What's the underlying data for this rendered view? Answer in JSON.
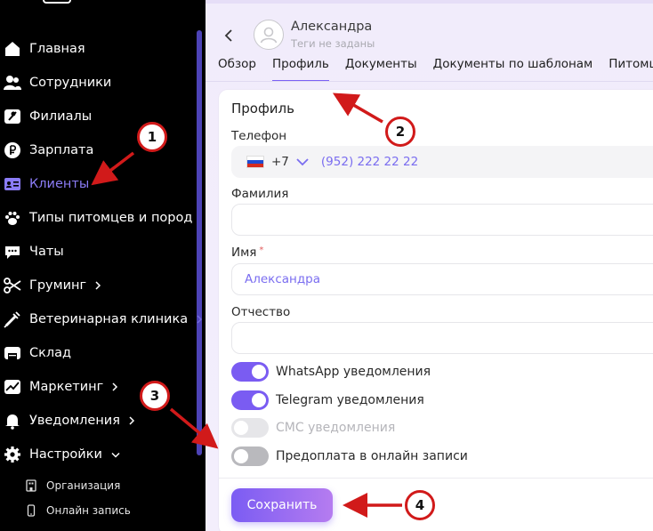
{
  "sidebar": {
    "items": [
      {
        "label": "Главная",
        "icon": "home-icon"
      },
      {
        "label": "Сотрудники",
        "icon": "people-icon"
      },
      {
        "label": "Филиалы",
        "icon": "map-pin-icon"
      },
      {
        "label": "Зарплата",
        "icon": "ruble-icon"
      },
      {
        "label": "Клиенты",
        "icon": "contact-card-icon",
        "active": true
      },
      {
        "label": "Типы питомцев и пород",
        "icon": "paw-icon"
      },
      {
        "label": "Чаты",
        "icon": "chat-icon"
      },
      {
        "label": "Груминг",
        "icon": "scissors-icon",
        "expandable": true
      },
      {
        "label": "Ветеринарная клиника",
        "icon": "syringe-icon",
        "expandable": true
      },
      {
        "label": "Склад",
        "icon": "warehouse-icon"
      },
      {
        "label": "Маркетинг",
        "icon": "chart-icon",
        "expandable": true
      },
      {
        "label": "Уведомления",
        "icon": "bell-icon",
        "expandable": true
      },
      {
        "label": "Настройки",
        "icon": "gear-icon",
        "expanded": true
      }
    ],
    "subitems": [
      {
        "label": "Организация",
        "icon": "building-icon"
      },
      {
        "label": "Онлайн запись",
        "icon": "phone-icon"
      }
    ],
    "active_color": "#8b7cf6"
  },
  "header": {
    "client_name": "Александра",
    "tags_placeholder": "Теги не заданы"
  },
  "tabs": [
    {
      "label": "Обзор"
    },
    {
      "label": "Профиль",
      "active": true
    },
    {
      "label": "Документы"
    },
    {
      "label": "Документы по шаблонам"
    },
    {
      "label": "Питомцы"
    }
  ],
  "profile": {
    "title": "Профиль",
    "phone": {
      "label": "Телефон",
      "country_code": "+7",
      "number": "(952) 222 22 22"
    },
    "last_name": {
      "label": "Фамилия",
      "value": ""
    },
    "first_name": {
      "label": "Имя",
      "required_mark": "*",
      "value": "Александра"
    },
    "middle_name": {
      "label": "Отчество",
      "value": ""
    },
    "toggles": [
      {
        "label": "WhatsApp уведомления",
        "state": "on"
      },
      {
        "label": "Telegram уведомления",
        "state": "on"
      },
      {
        "label": "СМС уведомления",
        "state": "disabled"
      },
      {
        "label": "Предоплата в онлайн записи",
        "state": "off"
      }
    ],
    "save_label": "Сохранить"
  },
  "annotations": [
    "1",
    "2",
    "3",
    "4"
  ],
  "colors": {
    "accent": "#7a5cf2",
    "annotation": "#d11a1a",
    "sidebar_bg": "#000000"
  }
}
